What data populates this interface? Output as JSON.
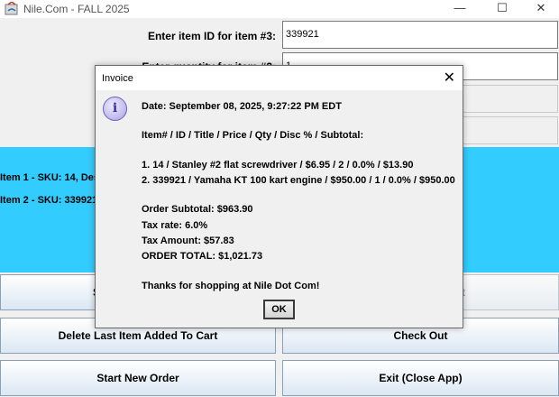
{
  "window": {
    "title": "Nile.Com - FALL 2025",
    "minimize": "—",
    "maximize": "☐",
    "close": "✕"
  },
  "form": {
    "item_id_label": "Enter item ID for item #3:",
    "item_id_value": "339921",
    "quantity_label": "Enter quantity for item #3:",
    "quantity_value": "1"
  },
  "cart": {
    "line1": "Item 1 - SKU: 14, Des",
    "line2": "Item 2 - SKU: 339921"
  },
  "buttons": {
    "search_partial": "S",
    "add_partial": "t",
    "delete_last": "Delete Last Item Added To Cart",
    "check_out": "Check Out",
    "start_new_order": "Start New Order",
    "exit": "Exit (Close App)"
  },
  "dialog": {
    "title": "Invoice",
    "close": "✕",
    "icon": "i",
    "date": "Date: September 08, 2025, 9:27:22 PM EDT",
    "header": "Item# / ID / Title / Price / Qty / Disc % / Subtotal:",
    "items": [
      "1. 14 / Stanley #2 flat screwdriver / $6.95 / 2 / 0.0% / $13.90",
      "2. 339921 / Yamaha KT 100 kart engine / $950.00 / 1 / 0.0% / $950.00"
    ],
    "order_subtotal": "Order Subtotal: $963.90",
    "tax_rate": "Tax rate: 6.0%",
    "tax_amount": "Tax Amount: $57.83",
    "order_total": "ORDER TOTAL: $1,021.73",
    "thanks": "Thanks for shopping at Nile Dot Com!",
    "ok": "OK"
  }
}
